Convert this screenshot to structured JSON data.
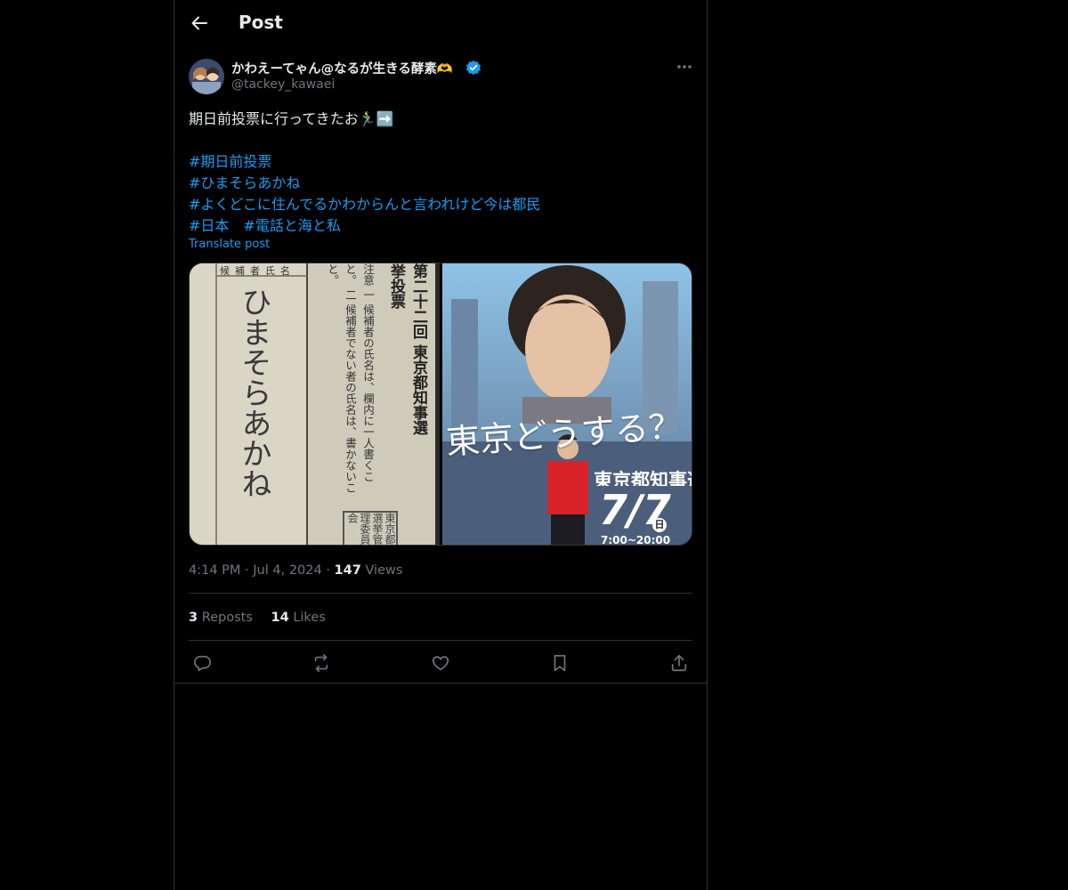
{
  "header": {
    "title": "Post"
  },
  "author": {
    "name": "かわえーてゃん@なるが生きる酵素🫶",
    "handle": "@tackey_kawaei"
  },
  "tweet": {
    "text": "期日前投票に行ってきたお🏃‍♂️➡️",
    "hashtags": [
      "#期日前投票",
      "#ひまそらあかね",
      "#よくどこに住んでるかわからんと言われけど今は都民",
      "#日本　#電話と海と私"
    ],
    "translate_label": "Translate post"
  },
  "media": {
    "left": {
      "ballot_header": "候補者氏名",
      "handwriting": "ひまそらあかね",
      "title": "第二十二回 東京都知事選挙投票",
      "notes": "注意 一 候補者の氏名は、欄内に一人書くこと。 二 候補者でない者の氏名は、書かないこと。",
      "seal": "東京都選挙管理委員会"
    },
    "right": {
      "headline": "東京どうする？",
      "election": "東京都知事選挙",
      "date": "7/7",
      "day": "日",
      "hours": "7:00~20:00"
    }
  },
  "meta": {
    "time": "4:14 PM",
    "date": "Jul 4, 2024",
    "views_count": "147",
    "views_label": "Views"
  },
  "stats": {
    "reposts_count": "3",
    "reposts_label": "Reposts",
    "likes_count": "14",
    "likes_label": "Likes"
  },
  "colors": {
    "accent": "#1d9bf0",
    "text": "#e7e9ea",
    "muted": "#71767b",
    "border": "#2f3336",
    "background": "#000000"
  }
}
